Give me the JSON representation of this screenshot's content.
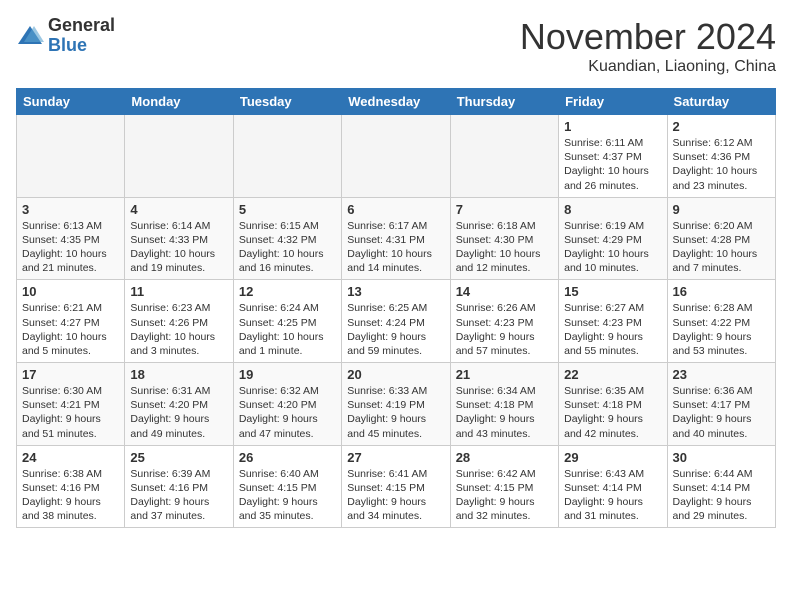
{
  "logo": {
    "general": "General",
    "blue": "Blue"
  },
  "header": {
    "month": "November 2024",
    "location": "Kuandian, Liaoning, China"
  },
  "weekdays": [
    "Sunday",
    "Monday",
    "Tuesday",
    "Wednesday",
    "Thursday",
    "Friday",
    "Saturday"
  ],
  "weeks": [
    [
      {
        "day": "",
        "info": ""
      },
      {
        "day": "",
        "info": ""
      },
      {
        "day": "",
        "info": ""
      },
      {
        "day": "",
        "info": ""
      },
      {
        "day": "",
        "info": ""
      },
      {
        "day": "1",
        "info": "Sunrise: 6:11 AM\nSunset: 4:37 PM\nDaylight: 10 hours\nand 26 minutes."
      },
      {
        "day": "2",
        "info": "Sunrise: 6:12 AM\nSunset: 4:36 PM\nDaylight: 10 hours\nand 23 minutes."
      }
    ],
    [
      {
        "day": "3",
        "info": "Sunrise: 6:13 AM\nSunset: 4:35 PM\nDaylight: 10 hours\nand 21 minutes."
      },
      {
        "day": "4",
        "info": "Sunrise: 6:14 AM\nSunset: 4:33 PM\nDaylight: 10 hours\nand 19 minutes."
      },
      {
        "day": "5",
        "info": "Sunrise: 6:15 AM\nSunset: 4:32 PM\nDaylight: 10 hours\nand 16 minutes."
      },
      {
        "day": "6",
        "info": "Sunrise: 6:17 AM\nSunset: 4:31 PM\nDaylight: 10 hours\nand 14 minutes."
      },
      {
        "day": "7",
        "info": "Sunrise: 6:18 AM\nSunset: 4:30 PM\nDaylight: 10 hours\nand 12 minutes."
      },
      {
        "day": "8",
        "info": "Sunrise: 6:19 AM\nSunset: 4:29 PM\nDaylight: 10 hours\nand 10 minutes."
      },
      {
        "day": "9",
        "info": "Sunrise: 6:20 AM\nSunset: 4:28 PM\nDaylight: 10 hours\nand 7 minutes."
      }
    ],
    [
      {
        "day": "10",
        "info": "Sunrise: 6:21 AM\nSunset: 4:27 PM\nDaylight: 10 hours\nand 5 minutes."
      },
      {
        "day": "11",
        "info": "Sunrise: 6:23 AM\nSunset: 4:26 PM\nDaylight: 10 hours\nand 3 minutes."
      },
      {
        "day": "12",
        "info": "Sunrise: 6:24 AM\nSunset: 4:25 PM\nDaylight: 10 hours\nand 1 minute."
      },
      {
        "day": "13",
        "info": "Sunrise: 6:25 AM\nSunset: 4:24 PM\nDaylight: 9 hours\nand 59 minutes."
      },
      {
        "day": "14",
        "info": "Sunrise: 6:26 AM\nSunset: 4:23 PM\nDaylight: 9 hours\nand 57 minutes."
      },
      {
        "day": "15",
        "info": "Sunrise: 6:27 AM\nSunset: 4:23 PM\nDaylight: 9 hours\nand 55 minutes."
      },
      {
        "day": "16",
        "info": "Sunrise: 6:28 AM\nSunset: 4:22 PM\nDaylight: 9 hours\nand 53 minutes."
      }
    ],
    [
      {
        "day": "17",
        "info": "Sunrise: 6:30 AM\nSunset: 4:21 PM\nDaylight: 9 hours\nand 51 minutes."
      },
      {
        "day": "18",
        "info": "Sunrise: 6:31 AM\nSunset: 4:20 PM\nDaylight: 9 hours\nand 49 minutes."
      },
      {
        "day": "19",
        "info": "Sunrise: 6:32 AM\nSunset: 4:20 PM\nDaylight: 9 hours\nand 47 minutes."
      },
      {
        "day": "20",
        "info": "Sunrise: 6:33 AM\nSunset: 4:19 PM\nDaylight: 9 hours\nand 45 minutes."
      },
      {
        "day": "21",
        "info": "Sunrise: 6:34 AM\nSunset: 4:18 PM\nDaylight: 9 hours\nand 43 minutes."
      },
      {
        "day": "22",
        "info": "Sunrise: 6:35 AM\nSunset: 4:18 PM\nDaylight: 9 hours\nand 42 minutes."
      },
      {
        "day": "23",
        "info": "Sunrise: 6:36 AM\nSunset: 4:17 PM\nDaylight: 9 hours\nand 40 minutes."
      }
    ],
    [
      {
        "day": "24",
        "info": "Sunrise: 6:38 AM\nSunset: 4:16 PM\nDaylight: 9 hours\nand 38 minutes."
      },
      {
        "day": "25",
        "info": "Sunrise: 6:39 AM\nSunset: 4:16 PM\nDaylight: 9 hours\nand 37 minutes."
      },
      {
        "day": "26",
        "info": "Sunrise: 6:40 AM\nSunset: 4:15 PM\nDaylight: 9 hours\nand 35 minutes."
      },
      {
        "day": "27",
        "info": "Sunrise: 6:41 AM\nSunset: 4:15 PM\nDaylight: 9 hours\nand 34 minutes."
      },
      {
        "day": "28",
        "info": "Sunrise: 6:42 AM\nSunset: 4:15 PM\nDaylight: 9 hours\nand 32 minutes."
      },
      {
        "day": "29",
        "info": "Sunrise: 6:43 AM\nSunset: 4:14 PM\nDaylight: 9 hours\nand 31 minutes."
      },
      {
        "day": "30",
        "info": "Sunrise: 6:44 AM\nSunset: 4:14 PM\nDaylight: 9 hours\nand 29 minutes."
      }
    ]
  ]
}
